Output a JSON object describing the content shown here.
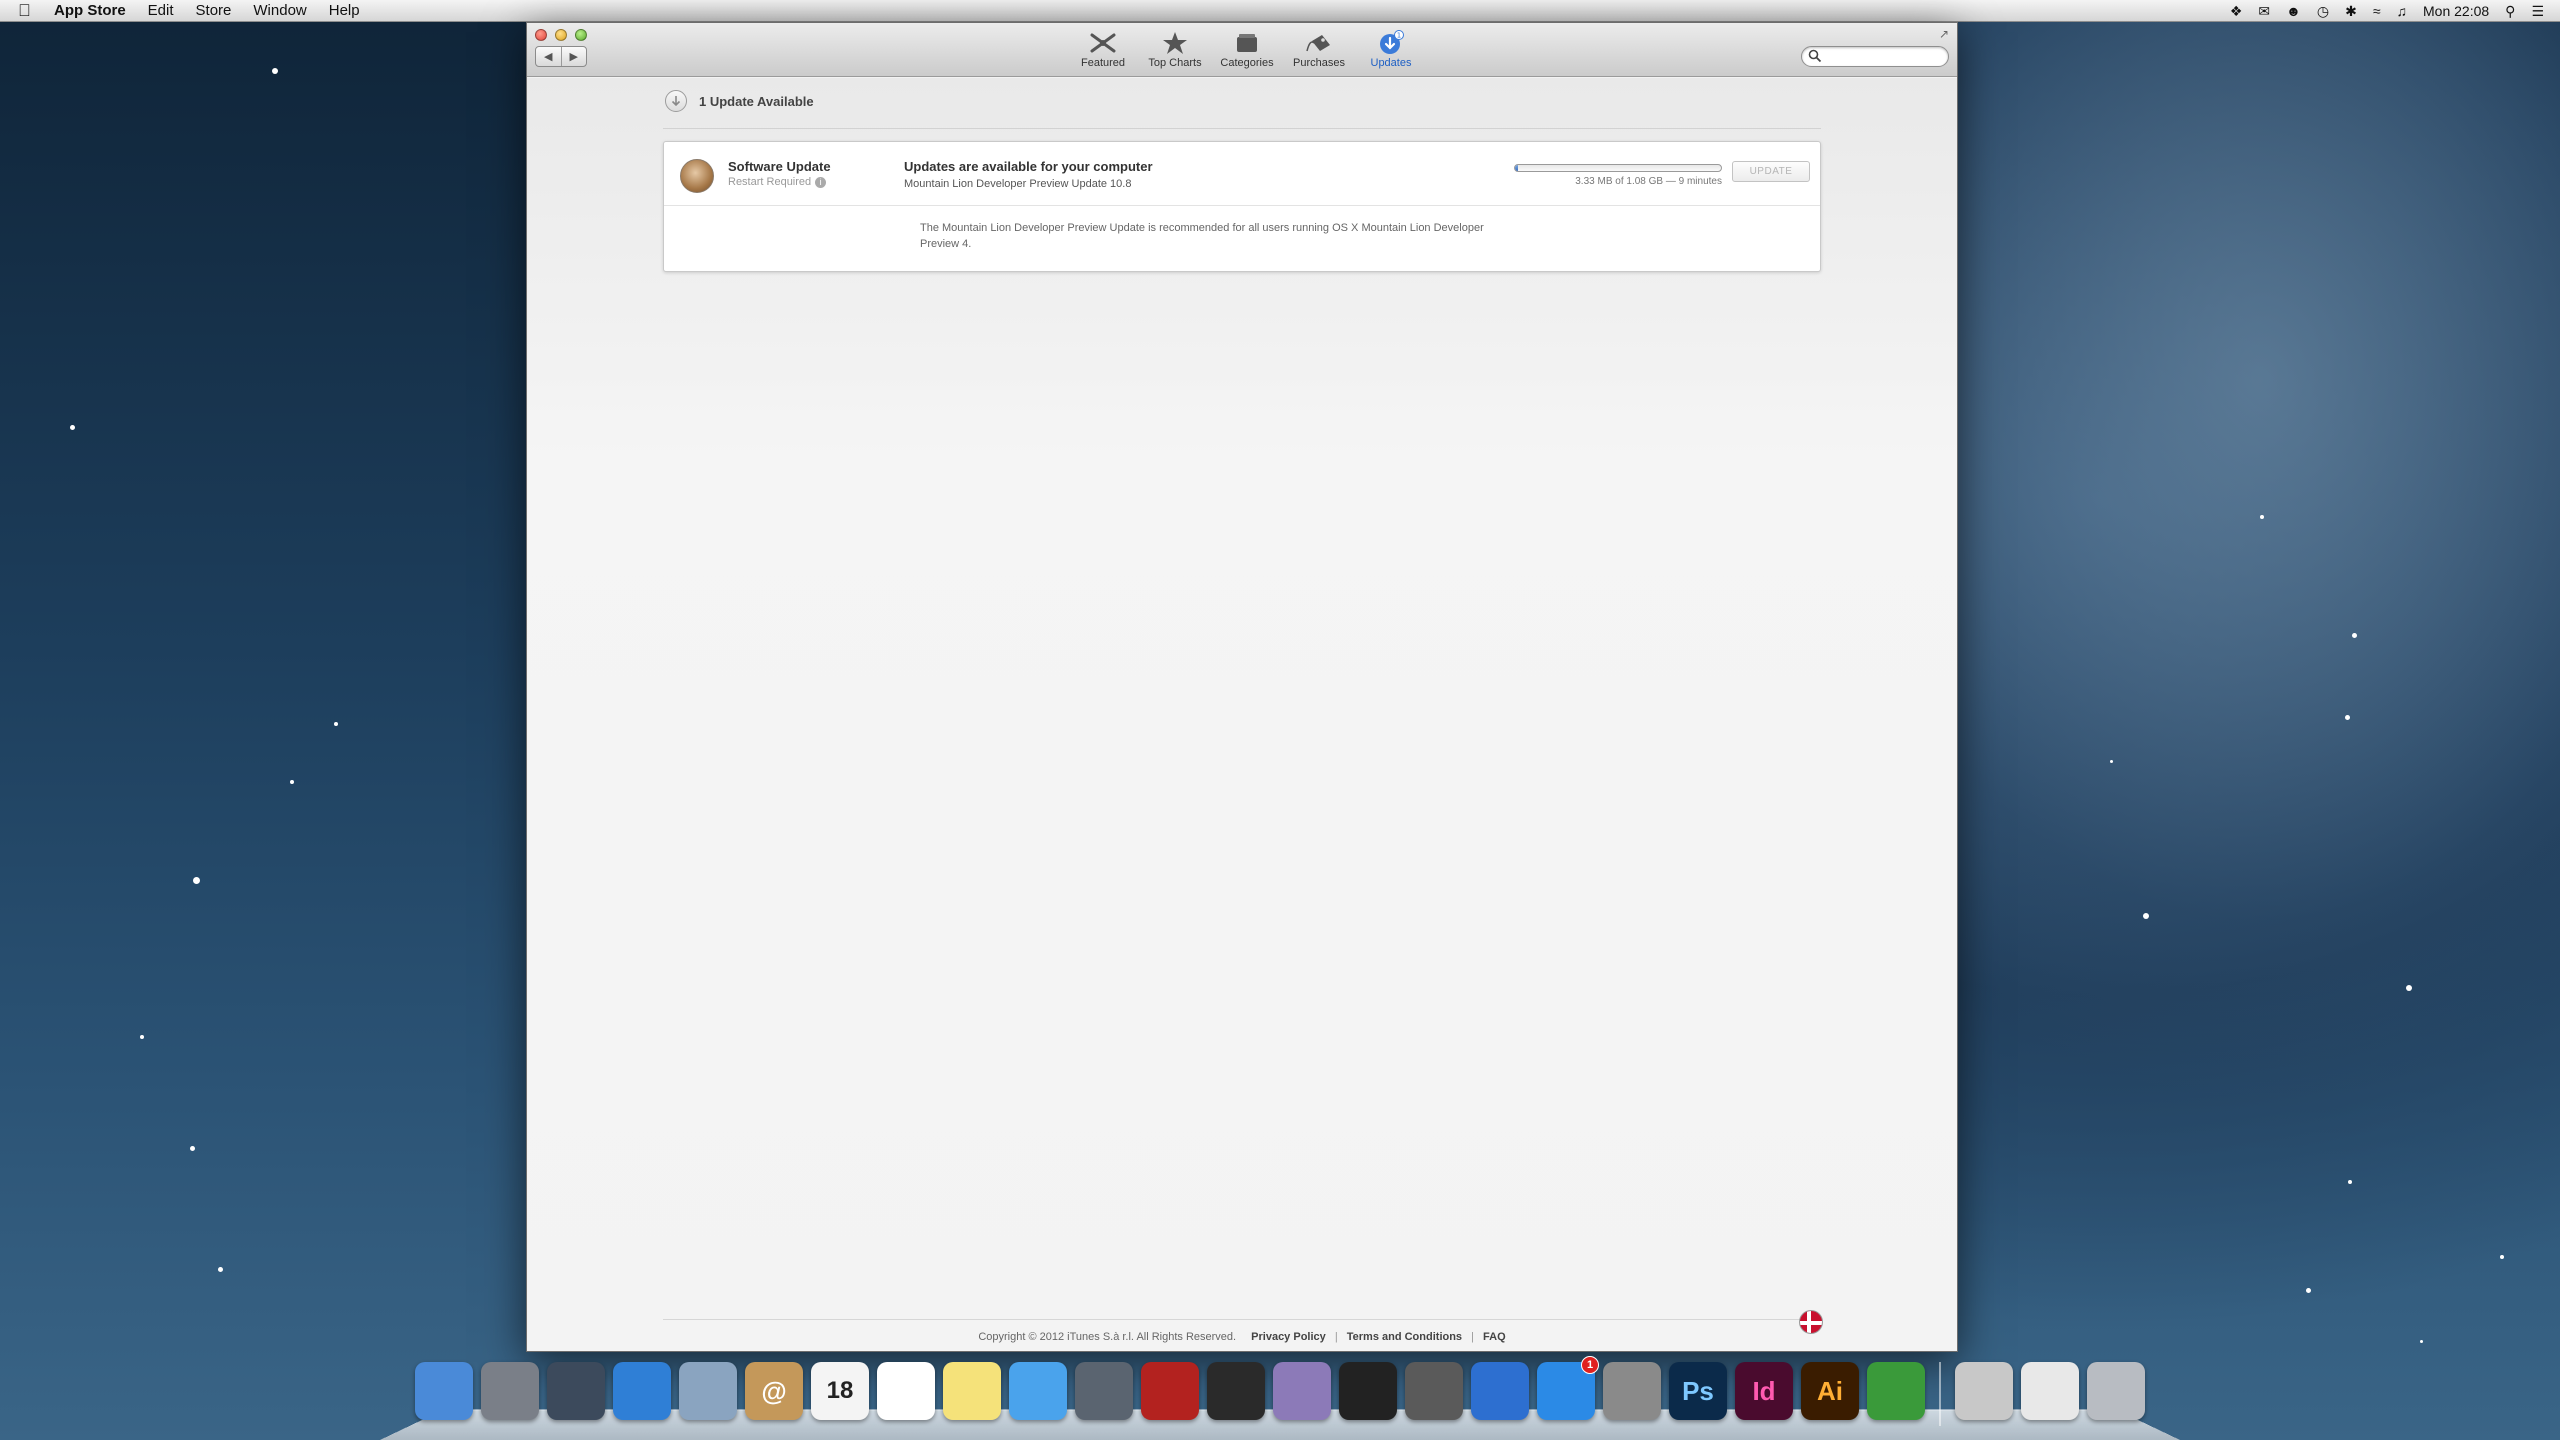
{
  "menubar": {
    "app_name": "App Store",
    "menus": [
      "Edit",
      "Store",
      "Window",
      "Help"
    ],
    "clock": "Mon 22:08"
  },
  "toolbar": {
    "items": [
      {
        "label": "Featured",
        "icon": "featured-icon"
      },
      {
        "label": "Top Charts",
        "icon": "star-icon"
      },
      {
        "label": "Categories",
        "icon": "categories-icon"
      },
      {
        "label": "Purchases",
        "icon": "purchases-tag-icon"
      },
      {
        "label": "Updates",
        "icon": "updates-icon",
        "active": true
      }
    ],
    "search_placeholder": ""
  },
  "updates": {
    "header": "1 Update Available",
    "item": {
      "name": "Software Update",
      "restart_note": "Restart Required",
      "title": "Updates are available for your computer",
      "subtitle": "Mountain Lion Developer Preview Update 10.8",
      "progress_fraction": 0.003,
      "progress_text": "3.33 MB of 1.08 GB — 9 minutes",
      "button_label": "UPDATE",
      "description": "The Mountain Lion Developer Preview Update is recommended for all users running OS X Mountain Lion Developer Preview 4."
    }
  },
  "footer": {
    "copyright": "Copyright © 2012 iTunes S.à r.l. All Rights Reserved.",
    "links": [
      "Privacy Policy",
      "Terms and Conditions",
      "FAQ"
    ]
  },
  "dock": {
    "app_store_badge": "1",
    "apps": [
      {
        "name": "finder",
        "label": "",
        "color": "#4a8ad8"
      },
      {
        "name": "launchpad",
        "label": "",
        "color": "#7a7f88"
      },
      {
        "name": "mission-control",
        "label": "",
        "color": "#3c4a5c"
      },
      {
        "name": "safari",
        "label": "",
        "color": "#2f7fd6"
      },
      {
        "name": "mail",
        "label": "",
        "color": "#8aa4c0"
      },
      {
        "name": "contacts",
        "label": "@",
        "color": "#c4985a"
      },
      {
        "name": "calendar",
        "label": "18",
        "color": "#f4f4f4"
      },
      {
        "name": "reminders",
        "label": "",
        "color": "#ffffff"
      },
      {
        "name": "notes",
        "label": "",
        "color": "#f5e27a"
      },
      {
        "name": "messages",
        "label": "",
        "color": "#4aa3ec"
      },
      {
        "name": "facetime",
        "label": "",
        "color": "#5a6470"
      },
      {
        "name": "photo-booth",
        "label": "",
        "color": "#b3221f"
      },
      {
        "name": "final-cut",
        "label": "",
        "color": "#2a2a2a"
      },
      {
        "name": "motion",
        "label": "",
        "color": "#8c7ab8"
      },
      {
        "name": "aperture",
        "label": "",
        "color": "#222222"
      },
      {
        "name": "iphoto",
        "label": "",
        "color": "#5a5a5a"
      },
      {
        "name": "itunes",
        "label": "",
        "color": "#2d6fd0"
      },
      {
        "name": "app-store",
        "label": "",
        "color": "#2b8ae6"
      },
      {
        "name": "system-preferences",
        "label": "",
        "color": "#8a8a8a"
      },
      {
        "name": "photoshop",
        "label": "Ps",
        "color": "#0b2a4a"
      },
      {
        "name": "indesign",
        "label": "Id",
        "color": "#4a0b2e"
      },
      {
        "name": "illustrator",
        "label": "Ai",
        "color": "#3a1c00"
      },
      {
        "name": "adium",
        "label": "",
        "color": "#3a9a3a"
      }
    ],
    "right_items": [
      {
        "name": "downloads-stack",
        "color": "#c8c8c8"
      },
      {
        "name": "documents-stack",
        "color": "#e8e8e8"
      },
      {
        "name": "trash",
        "color": "#b8bcc2"
      }
    ]
  }
}
